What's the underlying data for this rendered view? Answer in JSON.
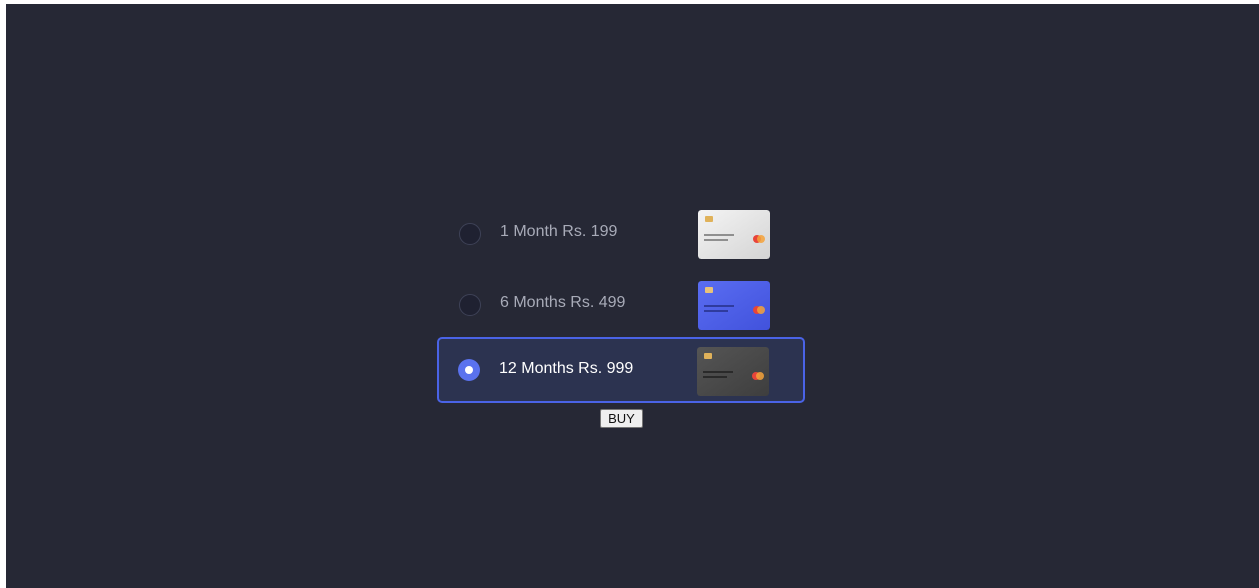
{
  "plans": [
    {
      "label": "1 Month Rs. 199",
      "selected": false,
      "card_style": "white"
    },
    {
      "label": "6 Months Rs. 499",
      "selected": false,
      "card_style": "blue"
    },
    {
      "label": "12 Months Rs. 999",
      "selected": true,
      "card_style": "dark"
    }
  ],
  "buy_label": "BUY",
  "colors": {
    "background": "#262835",
    "accent": "#4a63e6",
    "radio_checked": "#5a72ee",
    "selected_row": "#2c3350"
  }
}
